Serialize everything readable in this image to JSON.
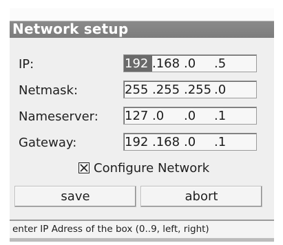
{
  "dialog": {
    "title": "Network setup"
  },
  "fields": [
    {
      "label": "IP:",
      "octets": [
        "192",
        ".168",
        ".0",
        ".5"
      ]
    },
    {
      "label": "Netmask:",
      "octets": [
        "255",
        ".255",
        ".255",
        ".0"
      ]
    },
    {
      "label": "Nameserver:",
      "octets": [
        "127",
        ".0",
        ".0",
        ".1"
      ]
    },
    {
      "label": "Gateway:",
      "octets": [
        "192",
        ".168",
        ".0",
        ".1"
      ]
    }
  ],
  "configure": {
    "label": "Configure Network",
    "checked": true
  },
  "buttons": {
    "save": "save",
    "abort": "abort"
  },
  "status": "enter IP Adress of the box (0..9, left, right)",
  "colors": {
    "titlebar": "#7c7c7c",
    "focus": "#6a6a6a",
    "background": "#efefef"
  },
  "icons": {
    "checkbox": "x-mark-icon"
  }
}
